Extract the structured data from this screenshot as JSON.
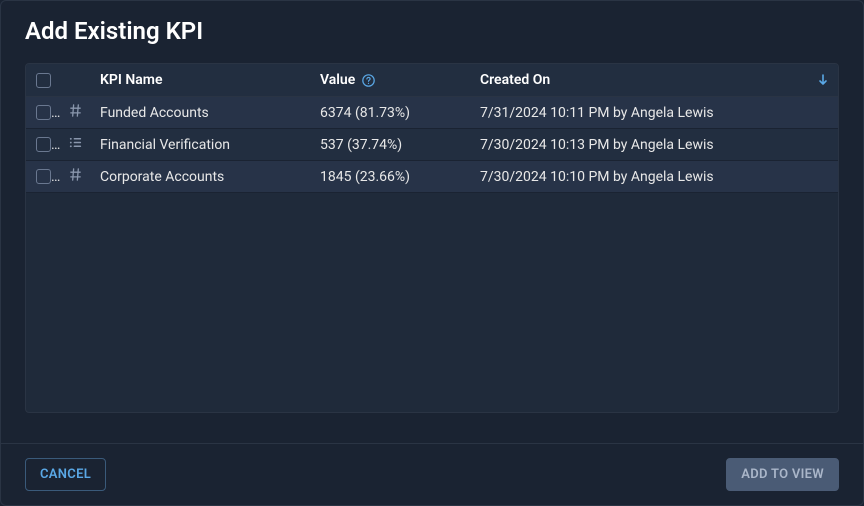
{
  "modal": {
    "title": "Add Existing KPI"
  },
  "table": {
    "headers": {
      "name": "KPI Name",
      "value": "Value",
      "created": "Created On"
    },
    "rows": [
      {
        "icon": "hash",
        "name": "Funded Accounts",
        "value": "6374 (81.73%)",
        "created": "7/31/2024 10:11 PM by Angela Lewis"
      },
      {
        "icon": "list",
        "name": "Financial Verification",
        "value": "537 (37.74%)",
        "created": "7/30/2024 10:13 PM by Angela Lewis"
      },
      {
        "icon": "hash",
        "name": "Corporate Accounts",
        "value": "1845 (23.66%)",
        "created": "7/30/2024 10:10 PM by Angela Lewis"
      }
    ]
  },
  "footer": {
    "cancel": "CANCEL",
    "submit": "ADD TO VIEW"
  }
}
